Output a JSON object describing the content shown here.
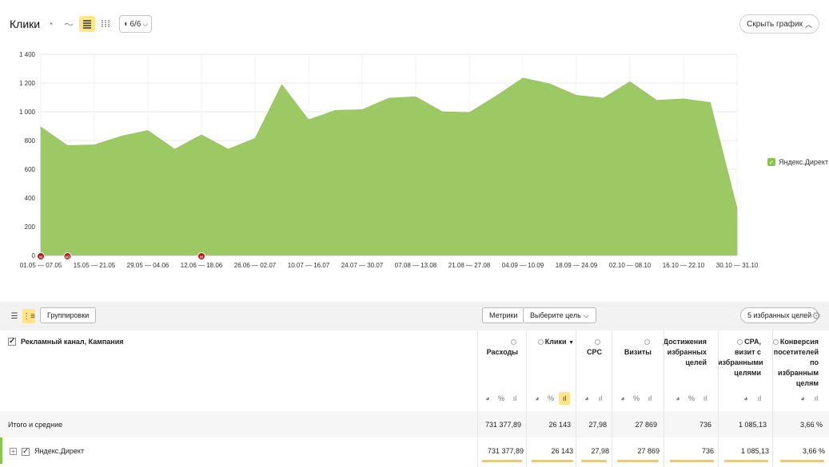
{
  "header": {
    "title": "Клики",
    "series_count": "6/6",
    "hide_chart_label": "Скрыть график"
  },
  "chart_data": {
    "type": "area",
    "title": "",
    "xlabel": "",
    "ylabel": "",
    "ylim": [
      0,
      1400
    ],
    "yticks": [
      "0",
      "200",
      "400",
      "600",
      "800",
      "1 000",
      "1 200",
      "1 400"
    ],
    "x_tick_labels": [
      "01.05 — 07.05",
      "15.05 — 21.05",
      "29.05 — 04.06",
      "12.06 — 18.06",
      "26.06 — 02.07",
      "10.07 — 16.07",
      "24.07 — 30.07",
      "07.08 — 13.08",
      "21.08 — 27.08",
      "04.09 — 10.09",
      "18.09 — 24.09",
      "02.10 — 08.10",
      "16.10 — 22.10",
      "30.10 — 31.10"
    ],
    "grid": true,
    "color": "#9cc963",
    "series": [
      {
        "name": "Яндекс.Директ",
        "values": [
          895,
          765,
          770,
          830,
          870,
          740,
          840,
          740,
          815,
          1190,
          945,
          1010,
          1015,
          1095,
          1105,
          1000,
          995,
          1110,
          1235,
          1195,
          1115,
          1095,
          1210,
          1080,
          1090,
          1065,
          330
        ]
      }
    ],
    "markers": [
      {
        "week_index": 0,
        "label": "м"
      },
      {
        "week_index": 1,
        "label": "м)"
      },
      {
        "week_index": 6,
        "label": "м"
      }
    ],
    "legend_position": "right"
  },
  "report": {
    "groupings_label": "Группировки",
    "metrics_label": "Метрики",
    "goal_select_label": "Выберите цель",
    "selected_goals_label": "5 избранных целей",
    "dimension_header": "Рекламный канал, Кампания",
    "columns": [
      "Расходы",
      "Клики",
      "CPC",
      "Визиты",
      "Достижения избранных целей",
      "CPA, визит с избранными целями",
      "Конверсия посетителей по избранным целям"
    ],
    "sort_indicator": "▼",
    "rows": [
      {
        "label": "Итого и средние",
        "values": [
          "731 377,89",
          "26 143",
          "27,98",
          "27 869",
          "736",
          "1 085,13",
          "3,66 %"
        ]
      },
      {
        "label": "Яндекс.Директ",
        "values": [
          "731 377,89",
          "26 143",
          "27,98",
          "27 869",
          "736",
          "1 085,13",
          "3,66 %"
        ]
      }
    ]
  }
}
